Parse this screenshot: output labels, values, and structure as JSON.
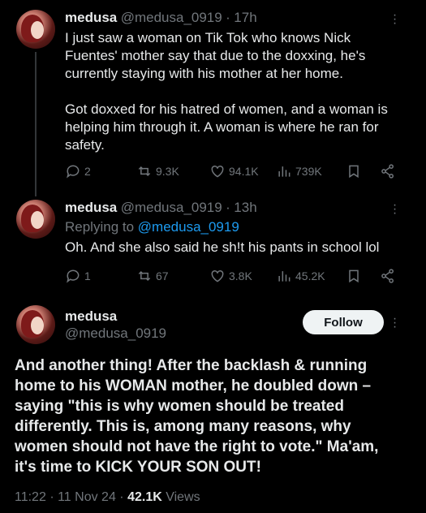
{
  "tweet1": {
    "name": "medusa",
    "handle": "@medusa_0919",
    "time": "17h",
    "para1": "I just saw a woman on Tik Tok who knows Nick Fuentes' mother say that due to the doxxing, he's currently staying with his mother at her home.",
    "para2": "Got doxxed for his hatred of women, and a woman is helping him through it. A woman is where he ran for safety.",
    "replies": "2",
    "reposts": "9.3K",
    "likes": "94.1K",
    "views": "739K"
  },
  "tweet2": {
    "name": "medusa",
    "handle": "@medusa_0919",
    "time": "13h",
    "replying_prefix": "Replying to ",
    "replying_to": "@medusa_0919",
    "text": "Oh. And she also said he sh!t his pants in school lol",
    "replies": "1",
    "reposts": "67",
    "likes": "3.8K",
    "views": "45.2K"
  },
  "main": {
    "name": "medusa",
    "handle": "@medusa_0919",
    "follow_label": "Follow",
    "text": "And another thing! After the backlash & running home to his WOMAN mother, he doubled down – saying \"this is why women should be treated differently. This is, among many reasons, why women should not have the right to vote.\" Ma'am, it's time to KICK YOUR SON OUT!",
    "time": "11:22",
    "date": "11 Nov 24",
    "views_count": "42.1K",
    "views_label": "Views"
  },
  "separator": "·",
  "icons": [
    "reply-icon",
    "repost-icon",
    "like-icon",
    "views-icon",
    "bookmark-icon",
    "share-icon",
    "more-icon"
  ],
  "colors": {
    "background": "#000000",
    "text": "#e7e9ea",
    "muted": "#71767b",
    "link": "#1d9bf0",
    "follow_bg": "#eff3f4"
  }
}
